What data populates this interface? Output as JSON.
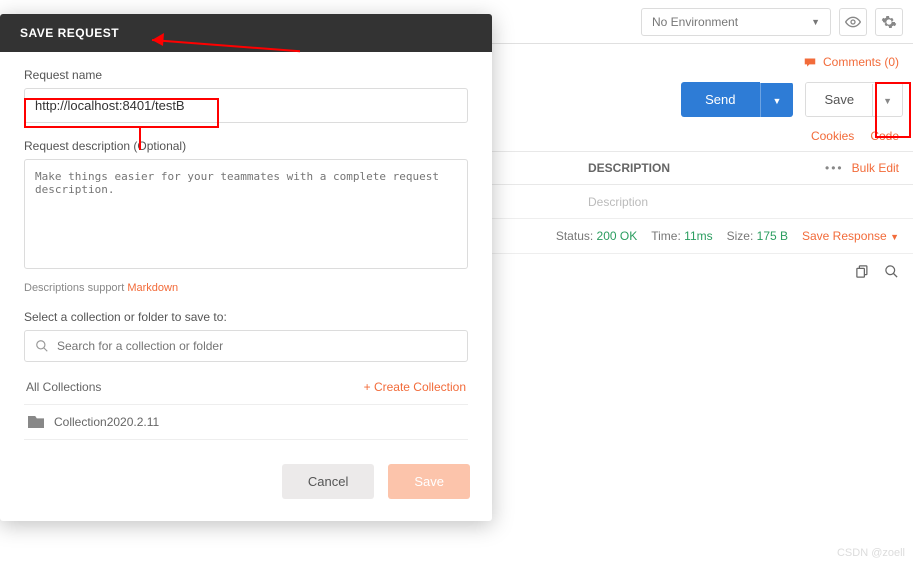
{
  "header": {
    "environment_label": "No Environment",
    "comments_label": "Comments (0)"
  },
  "request": {
    "send_label": "Send",
    "save_label": "Save",
    "cookies_label": "Cookies",
    "code_label": "Code"
  },
  "table": {
    "description_header": "DESCRIPTION",
    "bulk_edit_label": "Bulk Edit",
    "description_placeholder": "Description"
  },
  "response": {
    "status_label": "Status:",
    "status_value": "200 OK",
    "time_label": "Time:",
    "time_value": "11ms",
    "size_label": "Size:",
    "size_value": "175 B",
    "save_response_label": "Save Response"
  },
  "modal": {
    "title": "SAVE REQUEST",
    "request_name_label": "Request name",
    "request_name_value": "http://localhost:8401/testB",
    "request_description_label": "Request description (Optional)",
    "description_placeholder": "Make things easier for your teammates with a complete request description.",
    "hint_prefix": "Descriptions support ",
    "hint_link": "Markdown",
    "select_collection_label": "Select a collection or folder to save to:",
    "search_placeholder": "Search for a collection or folder",
    "all_collections_label": "All Collections",
    "create_collection_label": "+ Create Collection",
    "collection_item": "Collection2020.2.11",
    "cancel_label": "Cancel",
    "save_label": "Save"
  },
  "watermark": "CSDN @zoell"
}
